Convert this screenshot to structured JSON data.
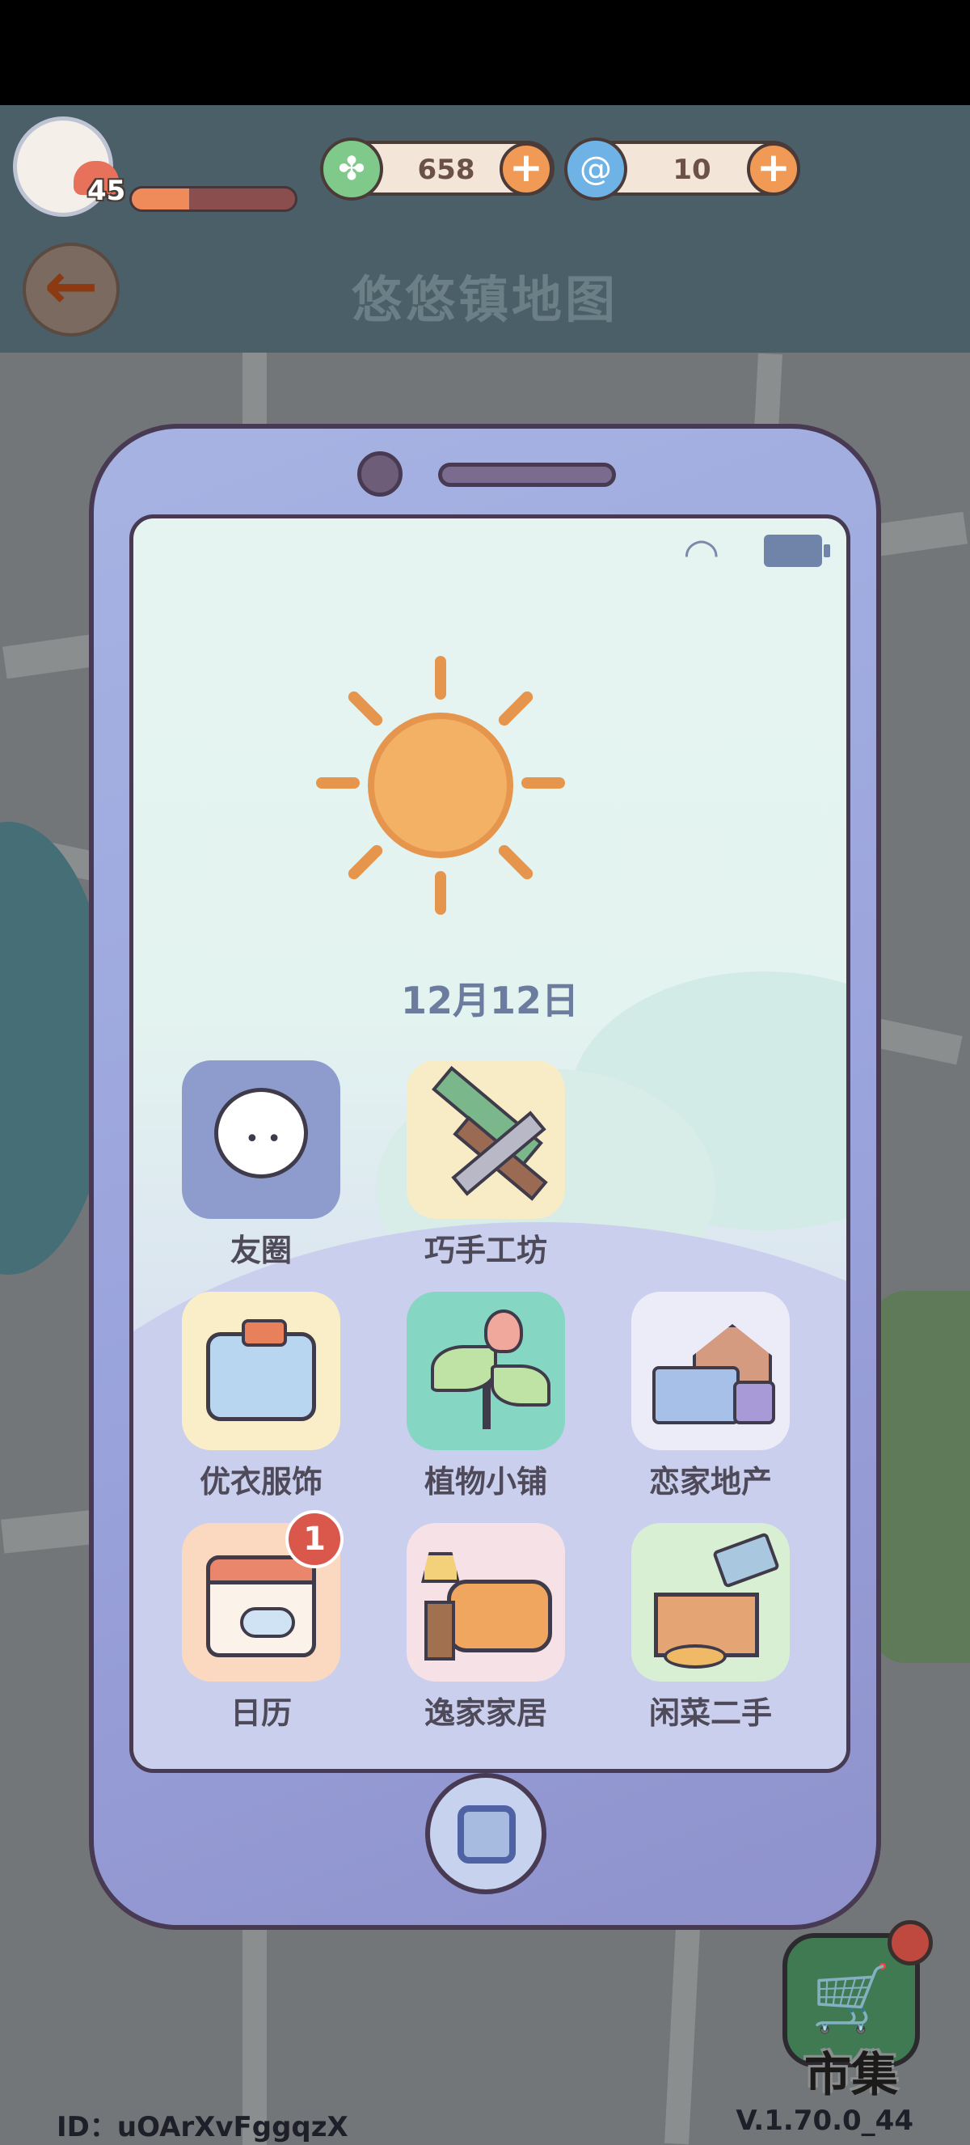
{
  "header": {
    "level": "45",
    "xp_fraction": 0.35,
    "currency_leaf": "658",
    "currency_swirl": "10",
    "title": "悠悠镇地图"
  },
  "phone": {
    "date": "12月12日",
    "weather": "sunny",
    "apps": [
      {
        "label": "友圈",
        "icon": "chat-bubble-icon"
      },
      {
        "label": "巧手工坊",
        "icon": "paintbrush-wrench-icon"
      },
      {
        "label": "优衣服饰",
        "icon": "shirt-icon"
      },
      {
        "label": "植物小铺",
        "icon": "plant-icon"
      },
      {
        "label": "恋家地产",
        "icon": "moving-truck-icon"
      },
      {
        "label": "日历",
        "icon": "calendar-icon",
        "badge": "1"
      },
      {
        "label": "逸家家居",
        "icon": "sofa-icon"
      },
      {
        "label": "闲菜二手",
        "icon": "box-tag-icon"
      }
    ]
  },
  "market": {
    "label": "市集"
  },
  "footer": {
    "id_text": "ID：uOArXvFggqzX",
    "version": "V.1.70.0_44"
  }
}
